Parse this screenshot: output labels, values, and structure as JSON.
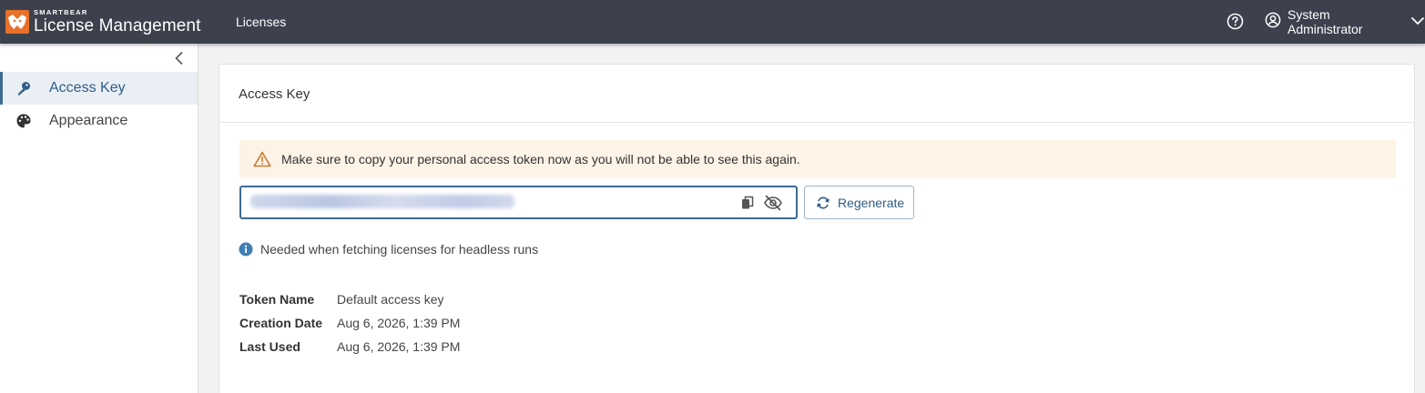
{
  "header": {
    "brand": "SMARTBEAR",
    "product": "License Management",
    "nav_licenses": "Licenses",
    "user_name": "System Administrator"
  },
  "sidebar": {
    "items": [
      {
        "label": "Access Key",
        "icon": "key-icon",
        "active": true
      },
      {
        "label": "Appearance",
        "icon": "palette-icon",
        "active": false
      }
    ]
  },
  "main": {
    "title": "Access Key",
    "warning": "Make sure to copy your personal access token now as you will not be able to see this again.",
    "token_value": "••••••••••••••••••••••••••••••••••••",
    "regenerate_label": "Regenerate",
    "info_text": "Needed when fetching licenses for headless runs",
    "details": [
      {
        "key": "Token Name",
        "value": "Default access key"
      },
      {
        "key": "Creation Date",
        "value": "Aug 6, 2026, 1:39 PM"
      },
      {
        "key": "Last Used",
        "value": "Aug 6, 2026, 1:39 PM"
      }
    ]
  },
  "colors": {
    "header_bg": "#3d414d",
    "brand_orange": "#e8702a",
    "accent_blue": "#2f5d87",
    "warning_bg": "#fdf3e6",
    "warning_icon": "#d9822b",
    "info_icon": "#3f7fb5"
  }
}
